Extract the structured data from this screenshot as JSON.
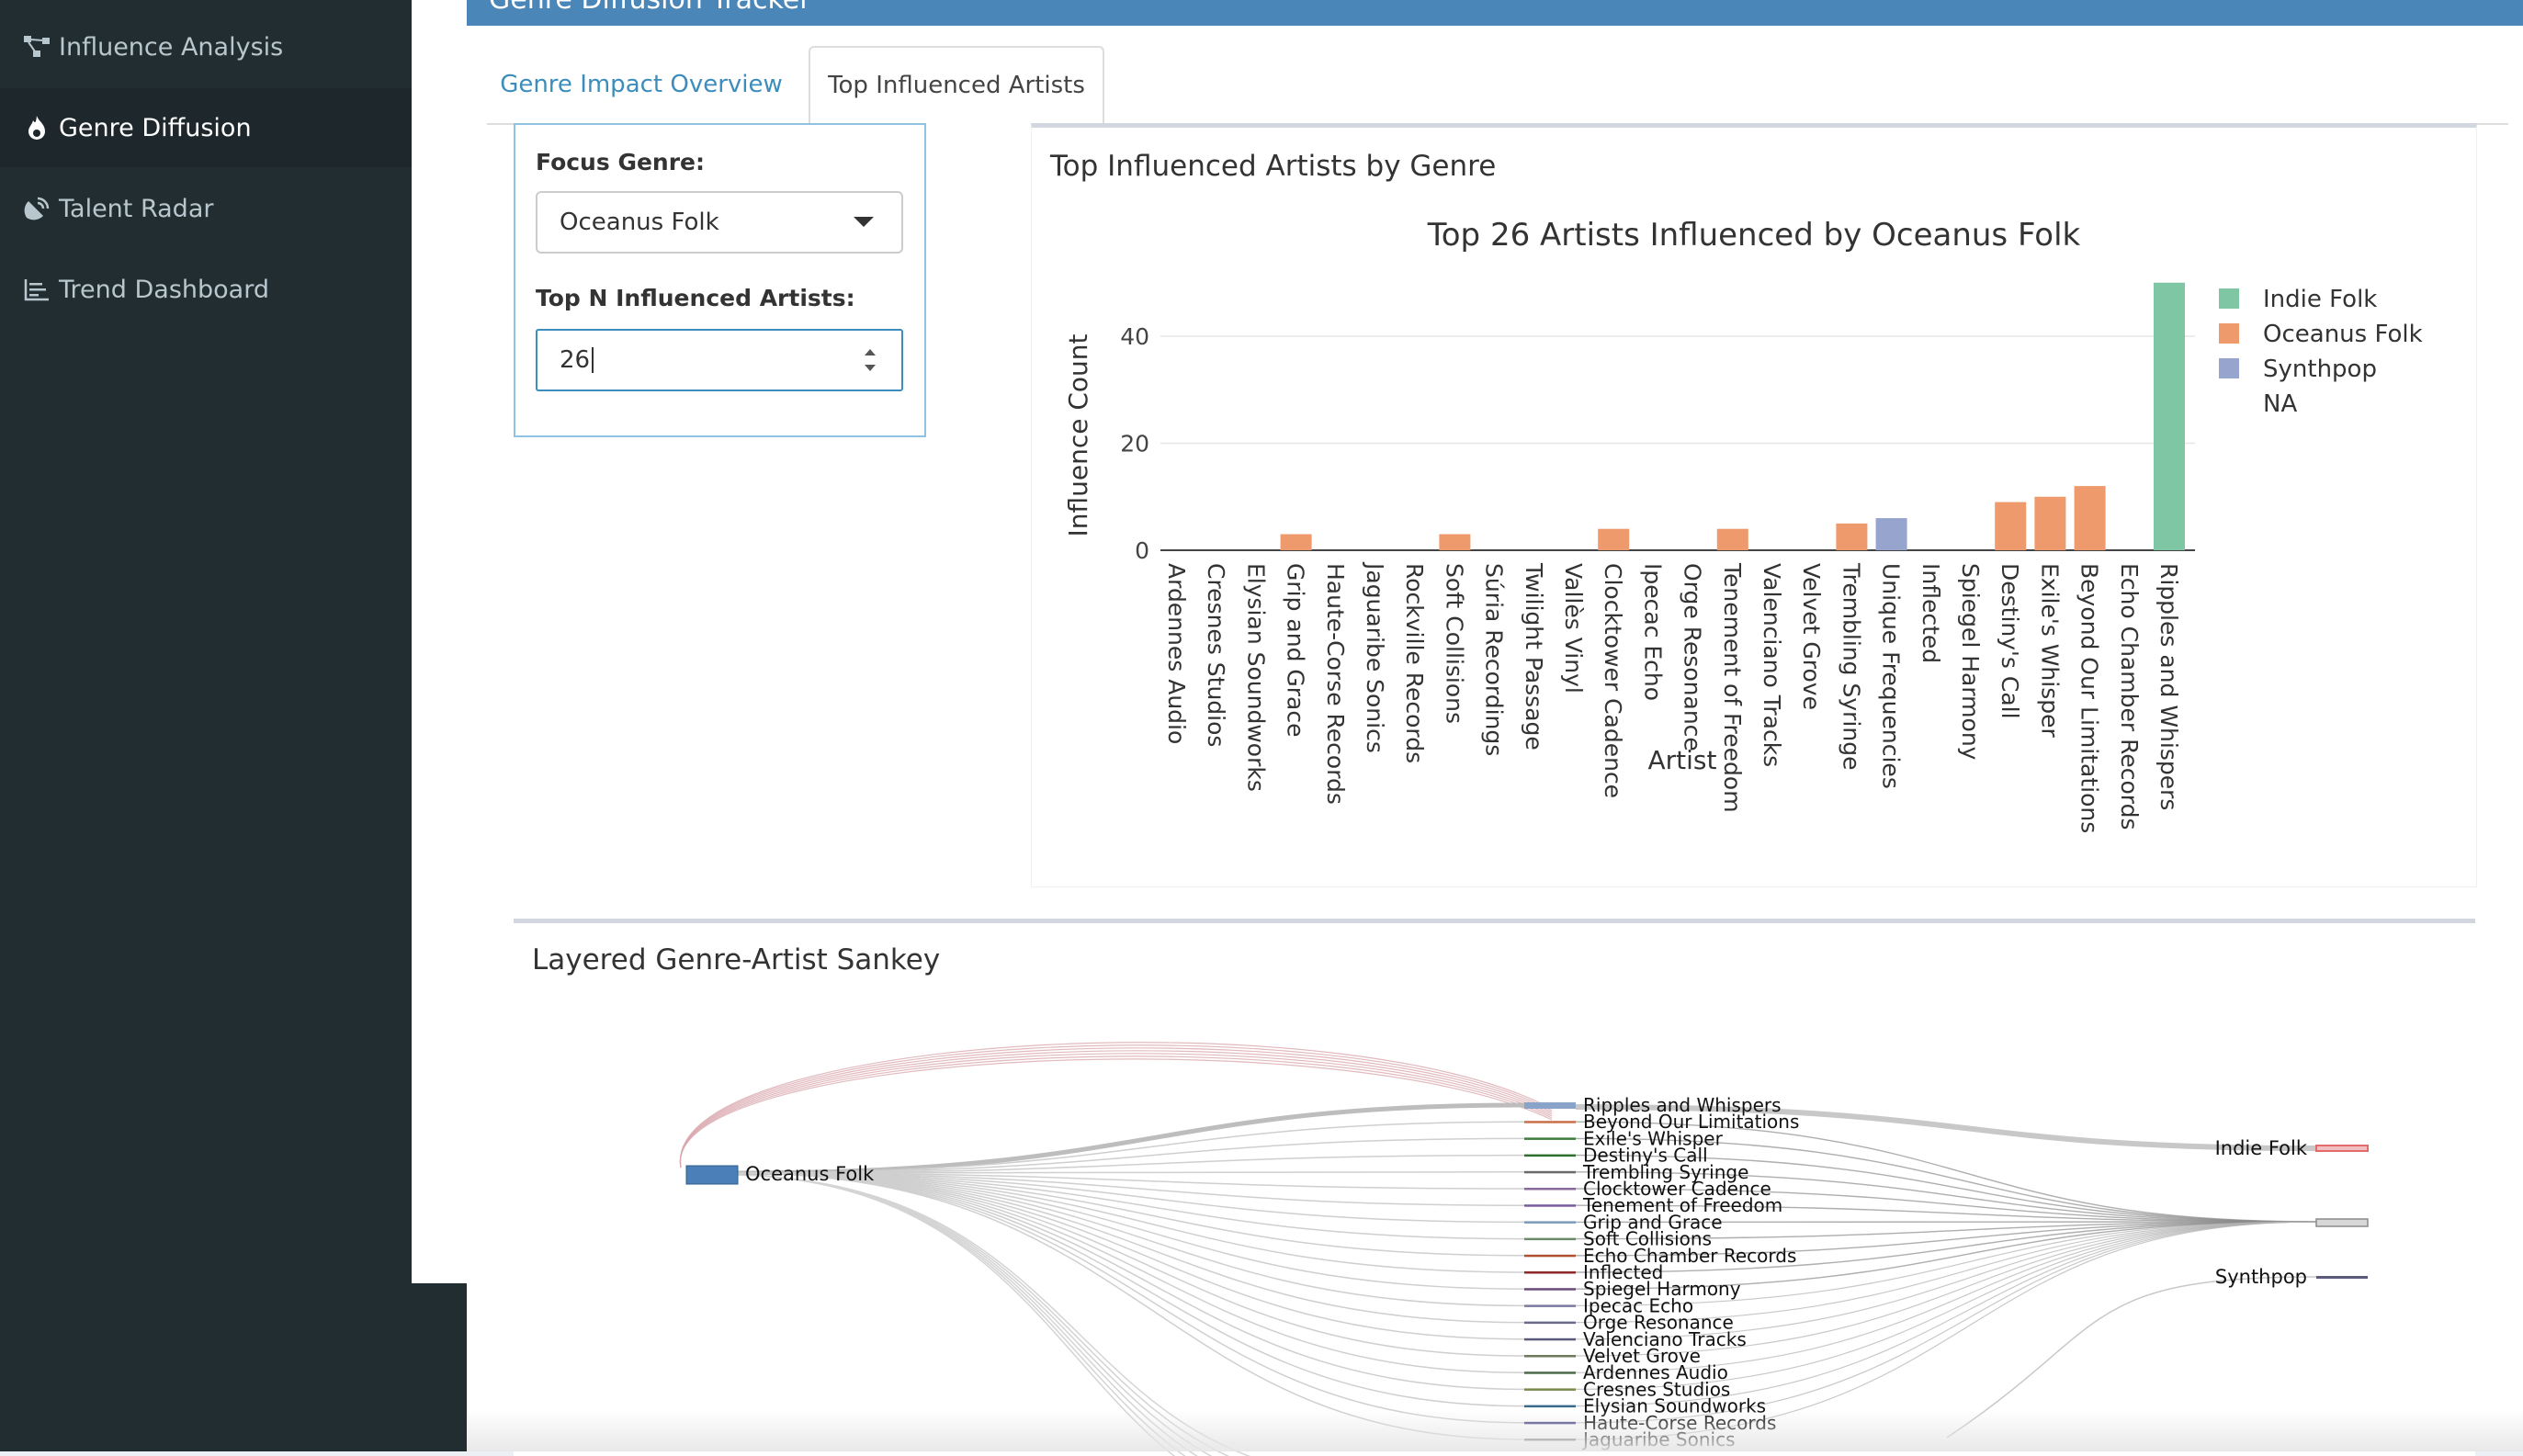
{
  "sidebar": {
    "items": [
      {
        "label": "Influence Analysis",
        "icon": "network-icon"
      },
      {
        "label": "Genre Diffusion",
        "icon": "fire-icon"
      },
      {
        "label": "Talent Radar",
        "icon": "satellite-icon"
      },
      {
        "label": "Trend Dashboard",
        "icon": "line-chart-icon"
      }
    ],
    "active": "Genre Diffusion"
  },
  "header": {
    "title": "Genre Diffusion Tracker"
  },
  "tabs": [
    {
      "label": "Genre Impact Overview"
    },
    {
      "label": "Top Influenced Artists"
    }
  ],
  "controls": {
    "focus_genre_label": "Focus Genre:",
    "focus_genre_value": "Oceanus Folk",
    "topn_label": "Top N Influenced Artists:",
    "topn_value": "26"
  },
  "chart_box": {
    "title": "Top Influenced Artists by Genre"
  },
  "chart_data": {
    "type": "bar",
    "title": "Top 26 Artists Influenced by Oceanus Folk",
    "xlabel": "Artist",
    "ylabel": "Influence Count",
    "ylim": [
      0,
      50
    ],
    "yticks": [
      0,
      20,
      40
    ],
    "grid": true,
    "legend_position": "right",
    "legend": [
      {
        "name": "Indie Folk",
        "color": "#7fc6a4"
      },
      {
        "name": "Oceanus Folk",
        "color": "#ef9a6c"
      },
      {
        "name": "Synthpop",
        "color": "#96a4ce"
      },
      {
        "name": "NA",
        "color": ""
      }
    ],
    "categories": [
      "Ardennes Audio",
      "Cresnes Studios",
      "Elysian Soundworks",
      "Grip and Grace",
      "Haute-Corse Records",
      "Jaguaribe Sonics",
      "Rockville Records",
      "Soft Collisions",
      "Súria Recordings",
      "Twilight Passage",
      "Vallès Vinyl",
      "Clocktower Cadence",
      "Ipecac Echo",
      "Orge Resonance",
      "Tenement of Freedom",
      "Valenciano Tracks",
      "Velvet Grove",
      "Trembling Syringe",
      "Unique Frequencies",
      "Inflected",
      "Spiegel Harmony",
      "Destiny's Call",
      "Exile's Whisper",
      "Beyond Our Limitations",
      "Echo Chamber Records",
      "Ripples and Whispers"
    ],
    "values": [
      0,
      0,
      0,
      3,
      0,
      0,
      0,
      3,
      0,
      0,
      0,
      4,
      0,
      0,
      4,
      0,
      0,
      5,
      6,
      0,
      0,
      9,
      10,
      12,
      0,
      50
    ],
    "bar_genres": [
      "NA",
      "NA",
      "NA",
      "Oceanus Folk",
      "NA",
      "NA",
      "NA",
      "Oceanus Folk",
      "NA",
      "NA",
      "NA",
      "Oceanus Folk",
      "NA",
      "NA",
      "Oceanus Folk",
      "NA",
      "NA",
      "Oceanus Folk",
      "Synthpop",
      "NA",
      "NA",
      "Oceanus Folk",
      "Oceanus Folk",
      "Oceanus Folk",
      "NA",
      "Indie Folk"
    ]
  },
  "sankey": {
    "title": "Layered Genre-Artist Sankey",
    "source_node": "Oceanus Folk",
    "artist_nodes": [
      "Ripples and Whispers",
      "Beyond Our Limitations",
      "Exile's Whisper",
      "Destiny's Call",
      "Trembling Syringe",
      "Clocktower Cadence",
      "Tenement of Freedom",
      "Grip and Grace",
      "Soft Collisions",
      "Echo Chamber Records",
      "Inflected",
      "Spiegel Harmony",
      "Ipecac Echo",
      "Orge Resonance",
      "Valenciano Tracks",
      "Velvet Grove",
      "Ardennes Audio",
      "Cresnes Studios",
      "Elysian Soundworks",
      "Haute-Corse Records",
      "Jaguaribe Sonics"
    ],
    "target_nodes": [
      "Indie Folk",
      "Synthpop"
    ],
    "colors": {
      "source": "#4b7fb8",
      "indie": "#e36b6b",
      "synthpop": "#5a5a7a"
    }
  }
}
